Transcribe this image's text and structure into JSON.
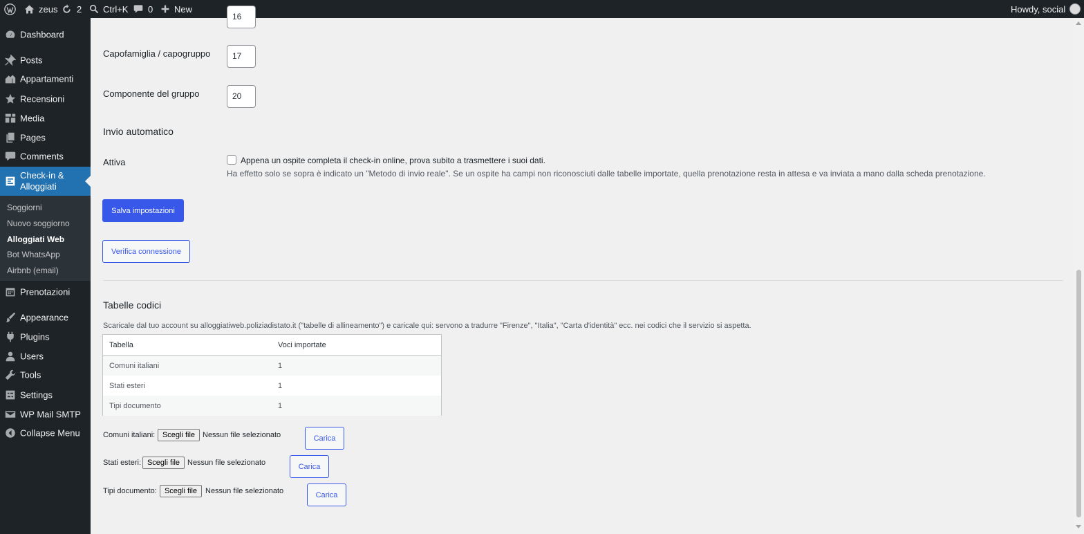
{
  "adminbar": {
    "site_name": "zeus",
    "updates_count": "2",
    "search_shortcut": "Ctrl+K",
    "comments_count": "0",
    "new_label": "New",
    "greeting": "Howdy, social"
  },
  "sidebar": {
    "items": [
      {
        "label": "Dashboard",
        "icon": "dashboard-icon"
      },
      {
        "label": "Posts",
        "icon": "pushpin-icon"
      },
      {
        "label": "Appartamenti",
        "icon": "building-icon"
      },
      {
        "label": "Recensioni",
        "icon": "star-icon"
      },
      {
        "label": "Media",
        "icon": "media-icon"
      },
      {
        "label": "Pages",
        "icon": "pages-icon"
      },
      {
        "label": "Comments",
        "icon": "comment-icon"
      },
      {
        "label": "Check-in & Alloggiati",
        "icon": "id-card-icon"
      },
      {
        "label": "Prenotazioni",
        "icon": "calendar-icon"
      },
      {
        "label": "Appearance",
        "icon": "paintbrush-icon"
      },
      {
        "label": "Plugins",
        "icon": "plugin-icon"
      },
      {
        "label": "Users",
        "icon": "user-icon"
      },
      {
        "label": "Tools",
        "icon": "wrench-icon"
      },
      {
        "label": "Settings",
        "icon": "settings-icon"
      },
      {
        "label": "WP Mail SMTP",
        "icon": "mail-icon"
      },
      {
        "label": "Collapse Menu",
        "icon": "collapse-icon"
      }
    ],
    "submenu": [
      "Soggiorni",
      "Nuovo soggiorno",
      "Alloggiati Web",
      "Bot WhatsApp",
      "Airbnb (email)"
    ]
  },
  "form": {
    "partial_value": "16",
    "rows": [
      {
        "label": "Capofamiglia / capogruppo",
        "value": "17"
      },
      {
        "label": "Componente del gruppo",
        "value": "20"
      }
    ],
    "auto_section_title": "Invio automatico",
    "activate_label": "Attiva",
    "activate_checkbox_text": "Appena un ospite completa il check-in online, prova subito a trasmettere i suoi dati.",
    "activate_checked": false,
    "activate_desc": "Ha effetto solo se sopra è indicato un \"Metodo di invio reale\". Se un ospite ha campi non riconosciuti dalle tabelle importate, quella prenotazione resta in attesa e va inviata a mano dalla scheda prenotazione.",
    "save_button": "Salva impostazioni",
    "verify_button": "Verifica connessione"
  },
  "codes": {
    "title": "Tabelle codici",
    "description": "Scaricale dal tuo account su alloggiatiweb.poliziadistato.it (\"tabelle di allineamento\") e caricale qui: servono a tradurre \"Firenze\", \"Italia\", \"Carta d'identità\" ecc. nei codici che il servizio si aspetta.",
    "table": {
      "headers": [
        "Tabella",
        "Voci importate"
      ],
      "rows": [
        [
          "Comuni italiani",
          "1"
        ],
        [
          "Stati esteri",
          "1"
        ],
        [
          "Tipi documento",
          "1"
        ]
      ]
    },
    "uploads": [
      {
        "label": "Comuni italiani:",
        "choose": "Scegli file",
        "status": "Nessun file selezionato",
        "submit": "Carica"
      },
      {
        "label": "Stati esteri:",
        "choose": "Scegli file",
        "status": "Nessun file selezionato",
        "submit": "Carica"
      },
      {
        "label": "Tipi documento:",
        "choose": "Scegli file",
        "status": "Nessun file selezionato",
        "submit": "Carica"
      }
    ]
  },
  "colors": {
    "adminbar_bg": "#1d2327",
    "menu_current": "#2271b1",
    "button_primary": "#3858e9",
    "page_bg": "#f0f0f1"
  }
}
